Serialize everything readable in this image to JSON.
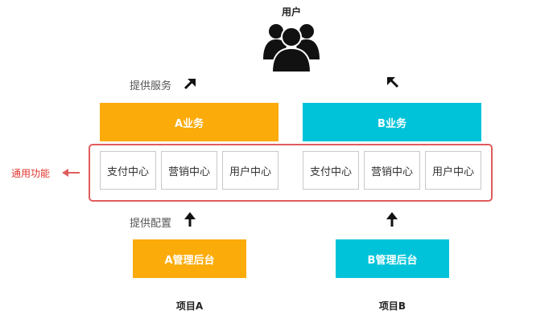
{
  "users": {
    "label": "用户",
    "icon": "users-group-icon"
  },
  "top_labels": {
    "provide_service": "提供服务",
    "provide_config": "提供配置"
  },
  "business": {
    "a": "A业务",
    "b": "B业务"
  },
  "common": {
    "label": "通用功能",
    "modules_a": [
      "支付中心",
      "营销中心",
      "用户中心"
    ],
    "modules_b": [
      "支付中心",
      "营销中心",
      "用户中心"
    ]
  },
  "admin": {
    "a": "A管理后台",
    "b": "B管理后台"
  },
  "projects": {
    "a": "项目A",
    "b": "项目B"
  },
  "colors": {
    "orange": "#fbab0a",
    "cyan": "#00c3d9",
    "highlight": "#e05c5c",
    "arrow": "#111111"
  }
}
